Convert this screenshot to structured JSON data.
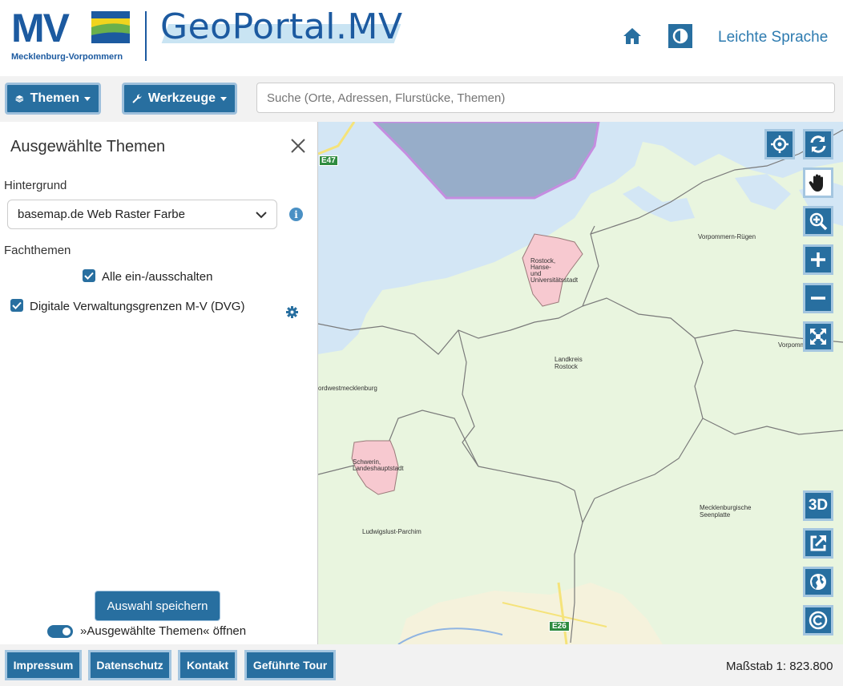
{
  "header": {
    "logo_text": "MV",
    "logo_subtitle": "Mecklenburg-Vorpommern",
    "app_title": "GeoPortal.MV",
    "easy_language": "Leichte Sprache",
    "accent": "#286fa0"
  },
  "toolbar": {
    "themes_label": "Themen",
    "tools_label": "Werkzeuge",
    "search_placeholder": "Suche (Orte, Adressen, Flurstücke, Themen)"
  },
  "panel": {
    "title": "Ausgewählte Themen",
    "background_label": "Hintergrund",
    "background_value": "basemap.de Web Raster Farbe",
    "topics_label": "Fachthemen",
    "toggle_all_label": "Alle ein-/ausschalten",
    "toggle_all_checked": true,
    "layers": [
      {
        "label": "Digitale Verwaltungsgrenzen M-V (DVG)",
        "checked": true
      }
    ],
    "save_label": "Auswahl speichern",
    "open_toggle_label": "»Ausgewählte Themen« öffnen",
    "open_toggle_on": true
  },
  "map": {
    "labels": {
      "rostock_city": [
        "Rostock,",
        "Hanse-",
        "und",
        "Universitätsstadt"
      ],
      "vorpommern_ruegen": "Vorpommern-Rügen",
      "vorpommern_cut": "Vorpomm",
      "landkreis_rostock": [
        "Landkreis",
        "Rostock"
      ],
      "nordwest": "ordwestmecklenburg",
      "schwerin": [
        "Schwerin,",
        "Landeshauptstadt"
      ],
      "seenplatte": [
        "Mecklenburgische",
        "Seenplatte"
      ],
      "ludwigslust": "Ludwigslust-Parchim",
      "road_e47": "E47",
      "road_e26": "E26"
    },
    "controls": [
      "locate-icon",
      "refresh-icon",
      "pan-hand-icon",
      "zoom-box-icon",
      "zoom-in-icon",
      "zoom-out-icon",
      "fullscreen-icon",
      "3d-icon",
      "share-icon",
      "globe-icon",
      "copyright-icon"
    ],
    "label_3d": "3D"
  },
  "footer": {
    "imprint": "Impressum",
    "privacy": "Datenschutz",
    "contact": "Kontakt",
    "tour": "Geführte Tour",
    "scale": "Maßstab 1: 823.800"
  }
}
